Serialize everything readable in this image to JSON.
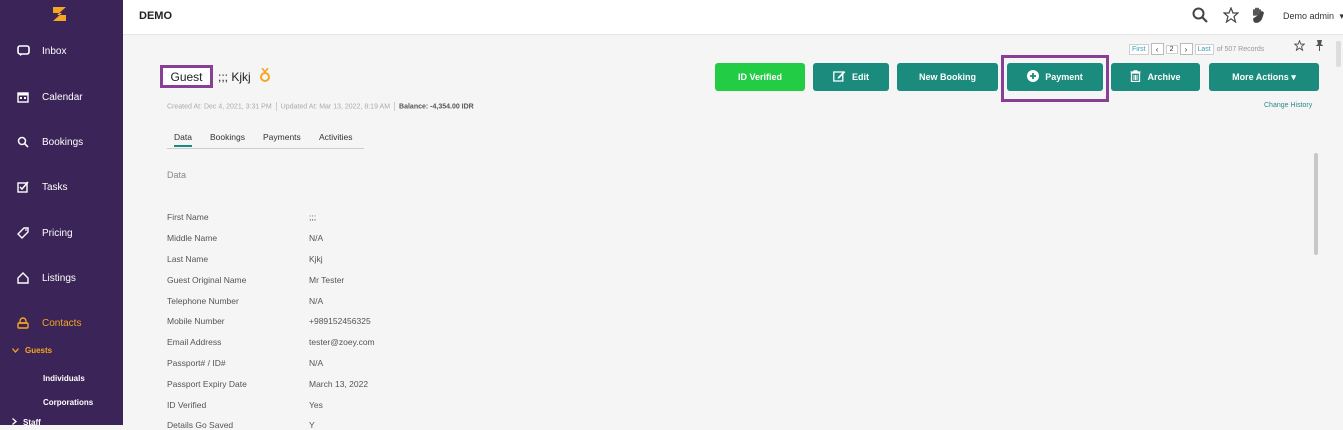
{
  "app": {
    "title": "DEMO",
    "user": "Demo admin"
  },
  "colors": {
    "sidebar": "#3b2457",
    "accent": "#f5a623",
    "teal": "#1a8b7d",
    "green": "#22cc44",
    "highlight": "#8a3f97"
  },
  "sidebar": {
    "items": [
      {
        "label": "Inbox",
        "icon": "inbox-icon"
      },
      {
        "label": "Calendar",
        "icon": "calendar-icon"
      },
      {
        "label": "Bookings",
        "icon": "bookings-icon"
      },
      {
        "label": "Tasks",
        "icon": "tasks-icon"
      },
      {
        "label": "Pricing",
        "icon": "tag-icon"
      },
      {
        "label": "Listings",
        "icon": "home-icon"
      },
      {
        "label": "Contacts",
        "icon": "contacts-icon"
      }
    ],
    "guests": "Guests",
    "sub_items": [
      "Individuals",
      "Corporations"
    ],
    "staff": "Staff"
  },
  "pager": {
    "first": "First",
    "page": "2",
    "last": "Last",
    "records": "of 507 Records"
  },
  "record": {
    "badge": "Guest",
    "name": ";;; Kjkj",
    "created": "Created At: Dec 4, 2021, 3:31 PM",
    "updated": "Updated At: Mar 13, 2022, 8:19 AM",
    "balance": "Balance: -4,354.00 IDR",
    "change_history": "Change History"
  },
  "actions": {
    "id_verified": "ID Verified",
    "edit": "Edit",
    "new_booking": "New Booking",
    "payment": "Payment",
    "archive": "Archive",
    "more_actions": "More Actions ▾"
  },
  "tabs": [
    "Data",
    "Bookings",
    "Payments",
    "Activities"
  ],
  "section_title": "Data",
  "fields": [
    {
      "label": "First Name",
      "value": ";;;"
    },
    {
      "label": "Middle Name",
      "value": "N/A"
    },
    {
      "label": "Last Name",
      "value": "Kjkj"
    },
    {
      "label": "Guest Original Name",
      "value": "Mr Tester"
    },
    {
      "label": "Telephone Number",
      "value": "N/A"
    },
    {
      "label": "Mobile Number",
      "value": "+989152456325"
    },
    {
      "label": "Email Address",
      "value": "tester@zoey.com"
    },
    {
      "label": "Passport# / ID#",
      "value": "N/A"
    },
    {
      "label": "Passport Expiry Date",
      "value": "March 13, 2022"
    },
    {
      "label": "ID Verified",
      "value": "Yes"
    },
    {
      "label": "Details Go Saved",
      "value": "Y"
    }
  ]
}
